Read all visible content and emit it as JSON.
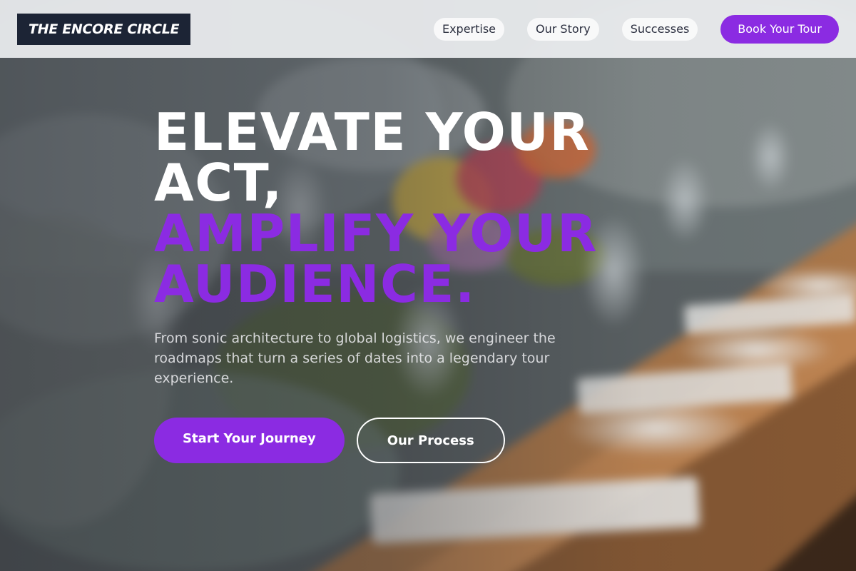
{
  "nav": {
    "logo": "THE ENCORE CIRCLE",
    "links": [
      {
        "label": "Expertise"
      },
      {
        "label": "Our Story"
      },
      {
        "label": "Successes"
      }
    ],
    "cta_label": "Book Your Tour"
  },
  "hero": {
    "headline_line1": "ELEVATE YOUR",
    "headline_line2": "ACT,",
    "headline_accent_line1": "AMPLIFY YOUR",
    "headline_accent_line2": "AUDIENCE.",
    "subcopy": "From sonic architecture to global logistics, we engineer the roadmaps that turn a series of dates into a legendary tour experience.",
    "primary_button": "Start Your Journey",
    "secondary_button": "Our Process"
  },
  "colors": {
    "accent": "#8b2be2",
    "logo_bg": "#1c2435",
    "nav_bg": "#eceef0"
  }
}
